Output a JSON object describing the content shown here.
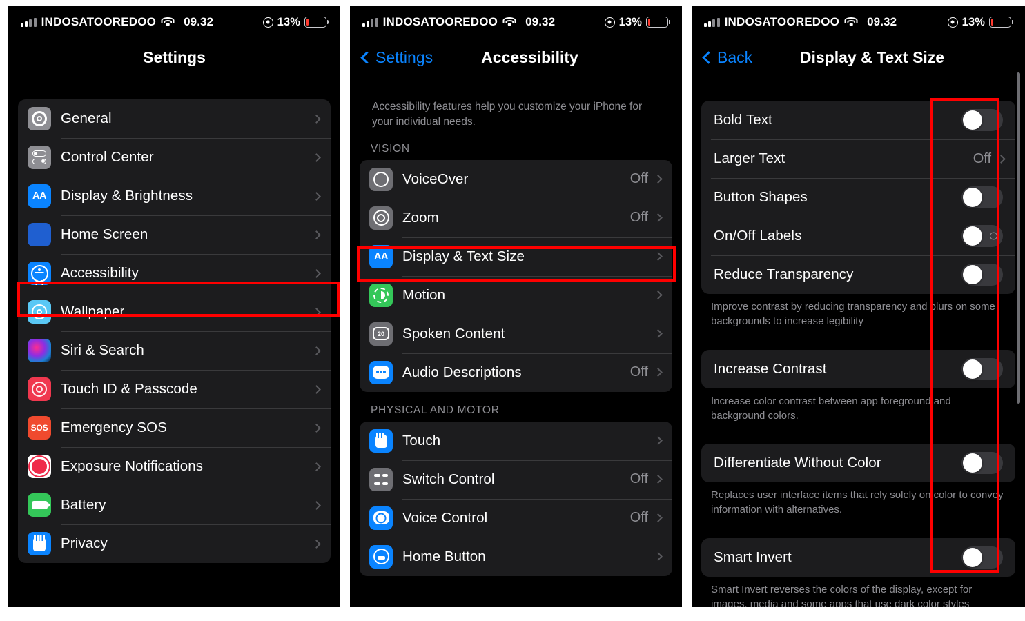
{
  "status_bar": {
    "carrier": "INDOSATOOREDOO",
    "time": "09.32",
    "battery_percent": "13%",
    "battery_level": 13,
    "wifi_icon": "wifi-icon",
    "location_icon": "location-services-icon"
  },
  "colors": {
    "accent_blue": "#0a84ff",
    "annotation_red": "#fe0000",
    "group_bg": "#1c1c1e",
    "screen_bg": "#000000",
    "secondary_text": "#8e8e93",
    "toggle_off_track": "#39393d"
  },
  "panel1": {
    "nav_title": "Settings",
    "groups": [
      {
        "id": "cut-off",
        "items": [
          {
            "label": "",
            "icon": "sounds-haptics-icon",
            "value": ""
          }
        ]
      },
      {
        "id": "main",
        "items": [
          {
            "label": "General",
            "icon": "gear-icon",
            "value": ""
          },
          {
            "label": "Control Center",
            "icon": "control-center-icon",
            "value": ""
          },
          {
            "label": "Display & Brightness",
            "icon": "display-brightness-icon",
            "value": ""
          },
          {
            "label": "Home Screen",
            "icon": "home-screen-icon",
            "value": ""
          },
          {
            "label": "Accessibility",
            "icon": "accessibility-icon",
            "value": ""
          },
          {
            "label": "Wallpaper",
            "icon": "wallpaper-icon",
            "value": ""
          },
          {
            "label": "Siri & Search",
            "icon": "siri-icon",
            "value": ""
          },
          {
            "label": "Touch ID & Passcode",
            "icon": "touch-id-icon",
            "value": ""
          },
          {
            "label": "Emergency SOS",
            "icon": "sos-icon",
            "value": ""
          },
          {
            "label": "Exposure Notifications",
            "icon": "exposure-notifications-icon",
            "value": ""
          },
          {
            "label": "Battery",
            "icon": "battery-icon",
            "value": ""
          },
          {
            "label": "Privacy",
            "icon": "privacy-hand-icon",
            "value": ""
          }
        ]
      }
    ],
    "highlight": "Accessibility"
  },
  "panel2": {
    "back_label": "Settings",
    "nav_title": "Accessibility",
    "intro": "Accessibility features help you customize your iPhone for your individual needs.",
    "section_vision_title": "VISION",
    "vision_items": [
      {
        "label": "VoiceOver",
        "icon": "voiceover-icon",
        "value": "Off"
      },
      {
        "label": "Zoom",
        "icon": "zoom-icon",
        "value": "Off"
      },
      {
        "label": "Display & Text Size",
        "icon": "display-text-size-icon",
        "value": ""
      },
      {
        "label": "Motion",
        "icon": "motion-icon",
        "value": ""
      },
      {
        "label": "Spoken Content",
        "icon": "spoken-content-icon",
        "value": ""
      },
      {
        "label": "Audio Descriptions",
        "icon": "audio-descriptions-icon",
        "value": "Off"
      }
    ],
    "section_physical_title": "PHYSICAL AND MOTOR",
    "physical_items": [
      {
        "label": "Touch",
        "icon": "touch-icon",
        "value": ""
      },
      {
        "label": "Switch Control",
        "icon": "switch-control-icon",
        "value": "Off"
      },
      {
        "label": "Voice Control",
        "icon": "voice-control-icon",
        "value": "Off"
      },
      {
        "label": "Home Button",
        "icon": "home-button-icon",
        "value": ""
      }
    ],
    "highlight": "Display & Text Size"
  },
  "panel3": {
    "back_label": "Back",
    "nav_title": "Display & Text Size",
    "group1": [
      {
        "label": "Bold Text",
        "control": "toggle",
        "state": "off"
      },
      {
        "label": "Larger Text",
        "control": "disclosure",
        "value": "Off"
      },
      {
        "label": "Button Shapes",
        "control": "toggle",
        "state": "off"
      },
      {
        "label": "On/Off Labels",
        "control": "toggle-with-labels",
        "state": "off"
      },
      {
        "label": "Reduce Transparency",
        "control": "toggle",
        "state": "off"
      }
    ],
    "footnote1": "Improve contrast by reducing transparency and blurs on some backgrounds to increase legibility",
    "group2": [
      {
        "label": "Increase Contrast",
        "control": "toggle",
        "state": "off"
      }
    ],
    "footnote2": "Increase color contrast between app foreground and background colors.",
    "group3": [
      {
        "label": "Differentiate Without Color",
        "control": "toggle",
        "state": "off"
      }
    ],
    "footnote3": "Replaces user interface items that rely solely on color to convey information with alternatives.",
    "group4": [
      {
        "label": "Smart Invert",
        "control": "toggle",
        "state": "off"
      }
    ],
    "footnote4": "Smart Invert reverses the colors of the display, except for images, media and some apps that use dark color styles"
  }
}
